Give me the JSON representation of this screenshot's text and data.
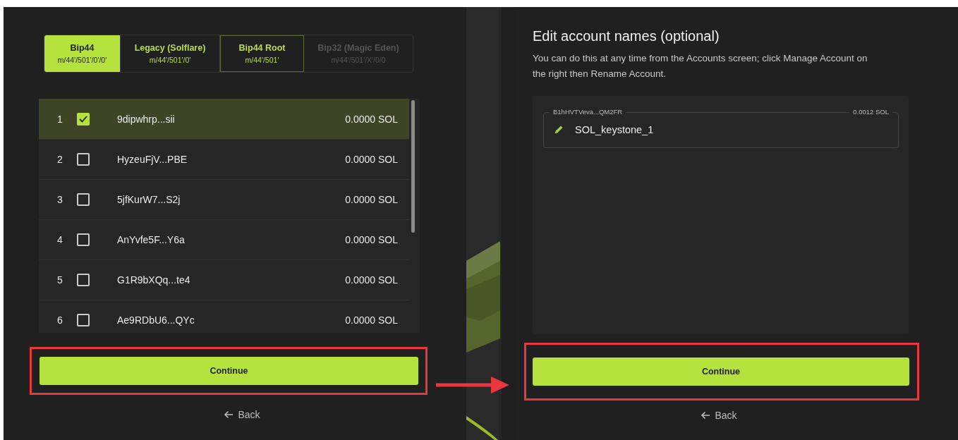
{
  "left": {
    "tabs": [
      {
        "label": "Bip44",
        "path": "m/44'/501'/0'/0'",
        "selected": true,
        "disabled": false
      },
      {
        "label": "Legacy (Solflare)",
        "path": "m/44'/501'/0'",
        "selected": false,
        "disabled": false
      },
      {
        "label": "Bip44 Root",
        "path": "m/44'/501'",
        "selected": false,
        "disabled": false
      },
      {
        "label": "Bip32 (Magic Eden)",
        "path": "m/44'/501'/X'/0/0",
        "selected": false,
        "disabled": true
      }
    ],
    "accounts": [
      {
        "index": "1",
        "address": "9dipwhrp...sii",
        "balance": "0.0000 SOL",
        "checked": true,
        "selected": true
      },
      {
        "index": "2",
        "address": "HyzeuFjV...PBE",
        "balance": "0.0000 SOL",
        "checked": false,
        "selected": false
      },
      {
        "index": "3",
        "address": "5jfKurW7...S2j",
        "balance": "0.0000 SOL",
        "checked": false,
        "selected": false
      },
      {
        "index": "4",
        "address": "AnYvfe5F...Y6a",
        "balance": "0.0000 SOL",
        "checked": false,
        "selected": false
      },
      {
        "index": "5",
        "address": "G1R9bXQq...te4",
        "balance": "0.0000 SOL",
        "checked": false,
        "selected": false
      },
      {
        "index": "6",
        "address": "Ae9RDbU6...QYc",
        "balance": "0.0000 SOL",
        "checked": false,
        "selected": false
      }
    ],
    "continue": {
      "label": "Continue",
      "highlighted": true
    },
    "back": "Back"
  },
  "right": {
    "title": "Edit account names (optional)",
    "description": "You can do this at any time from the Accounts screen; click Manage Account on the right then Rename Account.",
    "account_field": {
      "address": "B1hHVTVeva...QM2FR",
      "balance": "0.0012 SOL",
      "value": "SOL_keystone_1"
    },
    "continue": {
      "label": "Continue",
      "highlighted": true
    },
    "back": "Back"
  }
}
